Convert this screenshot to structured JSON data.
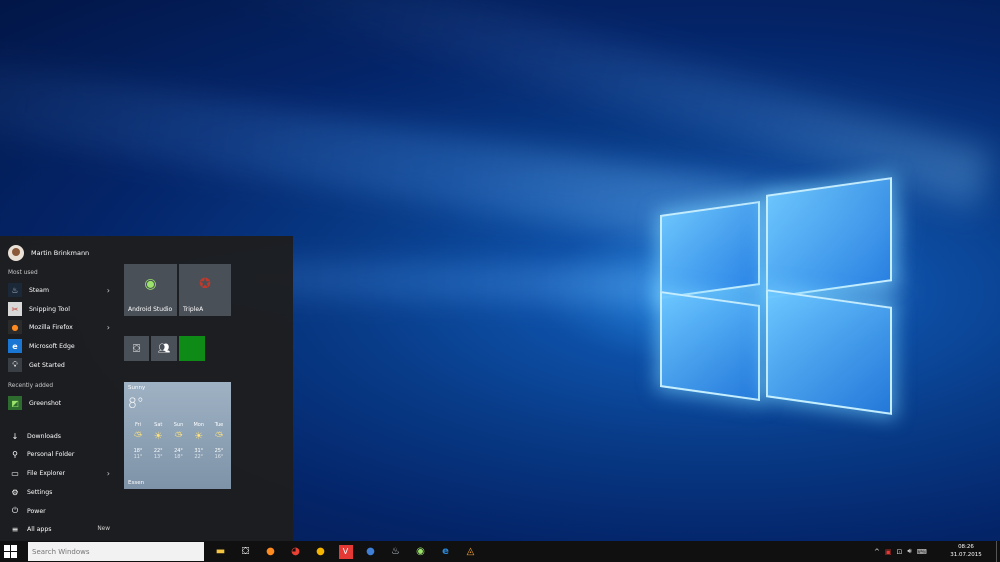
{
  "start_menu": {
    "user_name": "Martin Brinkmann",
    "most_used_label": "Most used",
    "most_used": [
      {
        "label": "Steam",
        "icon": "steam-icon",
        "has_submenu": true
      },
      {
        "label": "Snipping Tool",
        "icon": "scissors-icon",
        "has_submenu": false
      },
      {
        "label": "Mozilla Firefox",
        "icon": "firefox-icon",
        "has_submenu": true
      },
      {
        "label": "Microsoft Edge",
        "icon": "edge-icon",
        "has_submenu": false
      },
      {
        "label": "Get Started",
        "icon": "lightbulb-icon",
        "has_submenu": false
      }
    ],
    "recently_added_label": "Recently added",
    "recently_added": [
      {
        "label": "Greenshot",
        "icon": "greenshot-icon"
      }
    ],
    "places": [
      {
        "label": "Downloads",
        "icon": "download-icon",
        "has_submenu": false
      },
      {
        "label": "Personal Folder",
        "icon": "person-icon",
        "has_submenu": false
      },
      {
        "label": "File Explorer",
        "icon": "folder-icon",
        "has_submenu": true
      },
      {
        "label": "Settings",
        "icon": "gear-icon",
        "has_submenu": false
      },
      {
        "label": "Power",
        "icon": "power-icon",
        "has_submenu": false
      }
    ],
    "all_apps": {
      "label": "All apps",
      "new_label": "New"
    },
    "tiles": {
      "android_studio": "Android Studio",
      "triplea": "TripleA",
      "weather": {
        "condition": "Sunny",
        "temp": "8°",
        "city": "Essen",
        "days": [
          {
            "day": "Fri",
            "high": "18°",
            "low": "11°",
            "icon": "partly-cloudy-icon"
          },
          {
            "day": "Sat",
            "high": "22°",
            "low": "13°",
            "icon": "sun-icon"
          },
          {
            "day": "Sun",
            "high": "24°",
            "low": "18°",
            "icon": "partly-cloudy-icon"
          },
          {
            "day": "Mon",
            "high": "31°",
            "low": "22°",
            "icon": "sun-icon"
          },
          {
            "day": "Tue",
            "high": "25°",
            "low": "16°",
            "icon": "partly-cloudy-icon"
          }
        ]
      }
    }
  },
  "taskbar": {
    "search_placeholder": "Search Windows",
    "clock_time": "08:26",
    "clock_date": "31.07.2015",
    "pinned": [
      "file-explorer-icon",
      "store-icon",
      "firefox-icon",
      "chrome-icon",
      "chrome-canary-icon",
      "vivaldi-icon",
      "globe-icon",
      "steam-icon",
      "android-studio-icon",
      "edge-icon",
      "triplea-icon"
    ]
  }
}
